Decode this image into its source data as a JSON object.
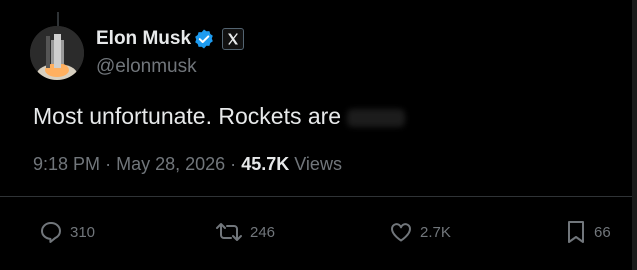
{
  "tweet": {
    "author_name": "Elon Musk",
    "handle": "@elonmusk",
    "text": "Most unfortunate. Rockets are",
    "time": "9:18 PM",
    "date": "May 28, 2026",
    "separator": "·",
    "views_count": "45.7K",
    "views_label": "Views"
  },
  "actions": {
    "replies": "310",
    "reposts": "246",
    "likes": "2.7K",
    "bookmarks": "66"
  },
  "icons": {
    "verified": "verified-badge-icon",
    "affiliate": "x-logo-icon",
    "reply": "reply-icon",
    "repost": "repost-icon",
    "like": "heart-icon",
    "bookmark": "bookmark-icon"
  },
  "colors": {
    "background": "#000000",
    "primary_text": "#e7e9ea",
    "secondary_text": "#71767b",
    "verified_blue": "#1d9bf0"
  }
}
